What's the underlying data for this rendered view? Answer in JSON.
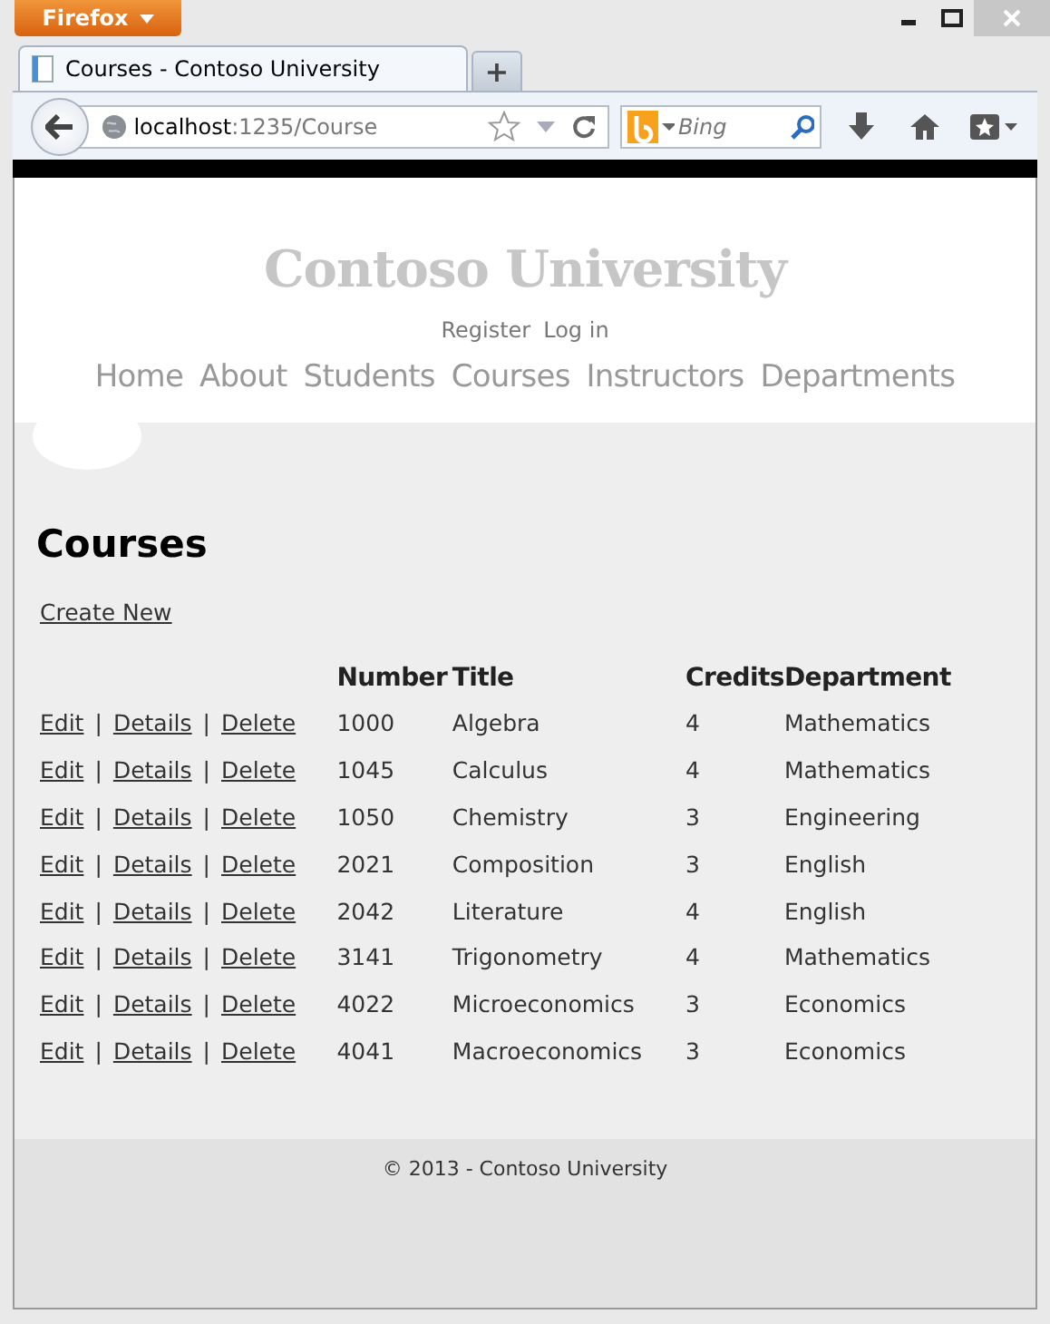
{
  "browser": {
    "menu_button": "Firefox",
    "tabs": [
      {
        "title": "Courses - Contoso University",
        "selected": true
      }
    ],
    "new_tab": "+",
    "url": {
      "host": "localhost",
      "path": ":1235/Course"
    },
    "search": {
      "placeholder": "Bing"
    }
  },
  "site": {
    "title": "Contoso University",
    "account_links": [
      "Register",
      "Log in"
    ],
    "nav": [
      "Home",
      "About",
      "Students",
      "Courses",
      "Instructors",
      "Departments"
    ]
  },
  "page": {
    "heading": "Courses",
    "create_link": "Create New",
    "table": {
      "columns": [
        "Number",
        "Title",
        "Credits",
        "Department"
      ],
      "rows": [
        {
          "actions": [
            "Edit",
            "Details",
            "Delete"
          ],
          "separators": [
            "|",
            "|"
          ],
          "cells": [
            "1000",
            "Algebra",
            "4",
            "Mathematics"
          ]
        },
        {
          "actions": [
            "Edit",
            "Details",
            "Delete"
          ],
          "separators": [
            "|",
            "|"
          ],
          "cells": [
            "1045",
            "Calculus",
            "4",
            "Mathematics"
          ]
        },
        {
          "actions": [
            "Edit",
            "Details",
            "Delete"
          ],
          "separators": [
            "|",
            "|"
          ],
          "cells": [
            "1050",
            "Chemistry",
            "3",
            "Engineering"
          ]
        },
        {
          "actions": [
            "Edit",
            "Details",
            "Delete"
          ],
          "separators": [
            "|",
            "|"
          ],
          "cells": [
            "2021",
            "Composition",
            "3",
            "English"
          ]
        },
        {
          "actions": [
            "Edit",
            "Details",
            "Delete"
          ],
          "separators": [
            "|",
            "|"
          ],
          "cells": [
            "2042",
            "Literature",
            "4",
            "English"
          ]
        },
        {
          "actions": [
            "Edit",
            "Details",
            "Delete"
          ],
          "separators": [
            "|",
            "|"
          ],
          "cells": [
            "3141",
            "Trigonometry",
            "4",
            "Mathematics"
          ]
        },
        {
          "actions": [
            "Edit",
            "Details",
            "Delete"
          ],
          "separators": [
            "|",
            "|"
          ],
          "cells": [
            "4022",
            "Microeconomics",
            "3",
            "Economics"
          ]
        },
        {
          "actions": [
            "Edit",
            "Details",
            "Delete"
          ],
          "separators": [
            "|",
            "|"
          ],
          "cells": [
            "4041",
            "Macroeconomics",
            "3",
            "Economics"
          ]
        }
      ]
    }
  },
  "footer": "© 2013 - Contoso University"
}
